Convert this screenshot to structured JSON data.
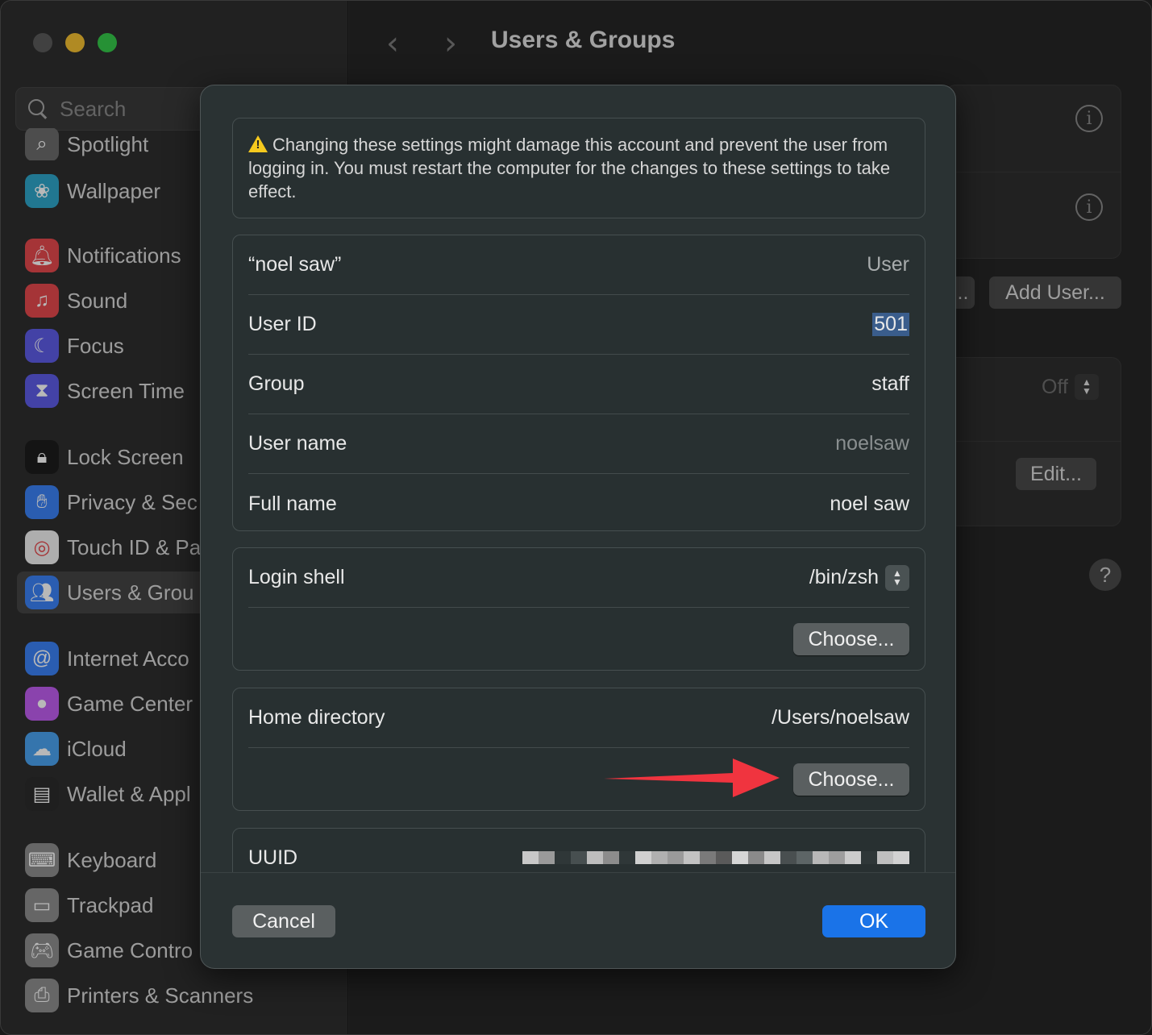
{
  "window": {
    "title": "Users & Groups"
  },
  "search": {
    "placeholder": "Search"
  },
  "sidebar": {
    "items": [
      {
        "label": "Spotlight",
        "icon": "spotlight-icon",
        "color": "#6b6b6b"
      },
      {
        "label": "Wallpaper",
        "icon": "wallpaper-icon",
        "color": "#2fa6c9"
      },
      {
        "label": "Notifications",
        "icon": "notifications-icon",
        "color": "#e5484d"
      },
      {
        "label": "Sound",
        "icon": "sound-icon",
        "color": "#e5484d"
      },
      {
        "label": "Focus",
        "icon": "focus-icon",
        "color": "#5e5ce6"
      },
      {
        "label": "Screen Time",
        "icon": "screen-time-icon",
        "color": "#5e5ce6"
      },
      {
        "label": "Lock Screen",
        "icon": "lock-icon",
        "color": "#1c1c1c"
      },
      {
        "label": "Privacy & Sec",
        "icon": "privacy-hand-icon",
        "color": "#3b82f6"
      },
      {
        "label": "Touch ID & Pa",
        "icon": "fingerprint-icon",
        "color": "#f2f2f2"
      },
      {
        "label": "Users & Grou",
        "icon": "users-icon",
        "color": "#3b82f6",
        "selected": true
      },
      {
        "label": "Internet Acco",
        "icon": "at-icon",
        "color": "#3b82f6"
      },
      {
        "label": "Game Center",
        "icon": "game-center-icon",
        "color": "#c05df0"
      },
      {
        "label": "iCloud",
        "icon": "icloud-icon",
        "color": "#4aa3f0"
      },
      {
        "label": "Wallet & Appl",
        "icon": "wallet-icon",
        "color": "#2b2b2b"
      },
      {
        "label": "Keyboard",
        "icon": "keyboard-icon",
        "color": "#8e8e8e"
      },
      {
        "label": "Trackpad",
        "icon": "trackpad-icon",
        "color": "#8e8e8e"
      },
      {
        "label": "Game Contro",
        "icon": "gamepad-icon",
        "color": "#8e8e8e"
      },
      {
        "label": "Printers & Scanners",
        "icon": "printer-icon",
        "color": "#8e8e8e"
      }
    ]
  },
  "background": {
    "add_user_label": "Add User...",
    "partial_button_label": "...",
    "off_label": "Off",
    "edit_label": "Edit...",
    "help_label": "?",
    "info_glyph": "i"
  },
  "sheet": {
    "warning": "Changing these settings might damage this account and prevent the user from logging in. You must restart the computer for the changes to these settings to take effect.",
    "account": {
      "name": "“noel saw”",
      "type": "User",
      "user_id_label": "User ID",
      "user_id_value": "501",
      "group_label": "Group",
      "group_value": "staff",
      "user_name_label": "User name",
      "user_name_value": "noelsaw",
      "full_name_label": "Full name",
      "full_name_value": "noel saw"
    },
    "login_shell": {
      "label": "Login shell",
      "value": "/bin/zsh",
      "choose_label": "Choose..."
    },
    "home_directory": {
      "label": "Home directory",
      "value": "/Users/noelsaw",
      "choose_label": "Choose..."
    },
    "uuid": {
      "label": "UUID"
    },
    "cancel_label": "Cancel",
    "ok_label": "OK"
  },
  "colors": {
    "accent": "#1a73e8",
    "annotation_arrow": "#f0343f"
  }
}
